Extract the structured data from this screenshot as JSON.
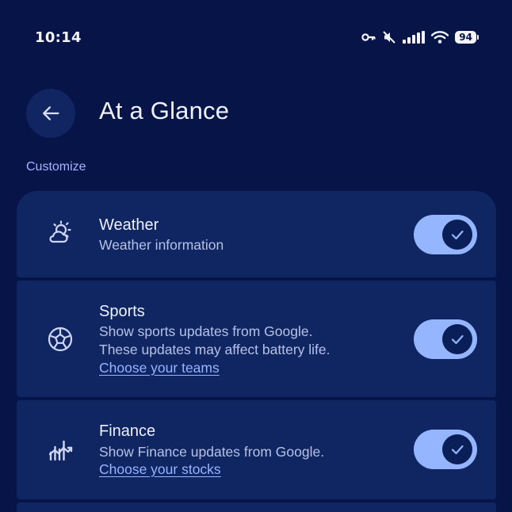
{
  "status_bar": {
    "time": "10:14",
    "battery": "94",
    "icons": [
      "key-icon",
      "mute-icon",
      "signal-icon",
      "wifi-icon",
      "battery-icon"
    ]
  },
  "header": {
    "back_icon": "arrow-back-icon",
    "title": "At a Glance"
  },
  "section": {
    "label": "Customize"
  },
  "cards": [
    {
      "icon": "weather-icon",
      "title": "Weather",
      "description": [
        "Weather information"
      ],
      "link": "",
      "enabled": true
    },
    {
      "icon": "soccer-ball-icon",
      "title": "Sports",
      "description": [
        "Show sports updates from Google.",
        "These updates may affect battery life."
      ],
      "link": "Choose your teams",
      "enabled": true
    },
    {
      "icon": "finance-chart-icon",
      "title": "Finance",
      "description": [
        "Show Finance updates from Google."
      ],
      "link": "Choose your stocks",
      "enabled": true
    }
  ],
  "colors": {
    "background": "#061447",
    "card": "#0f2663",
    "accent": "#95b6ff",
    "link": "#98b3ff"
  }
}
